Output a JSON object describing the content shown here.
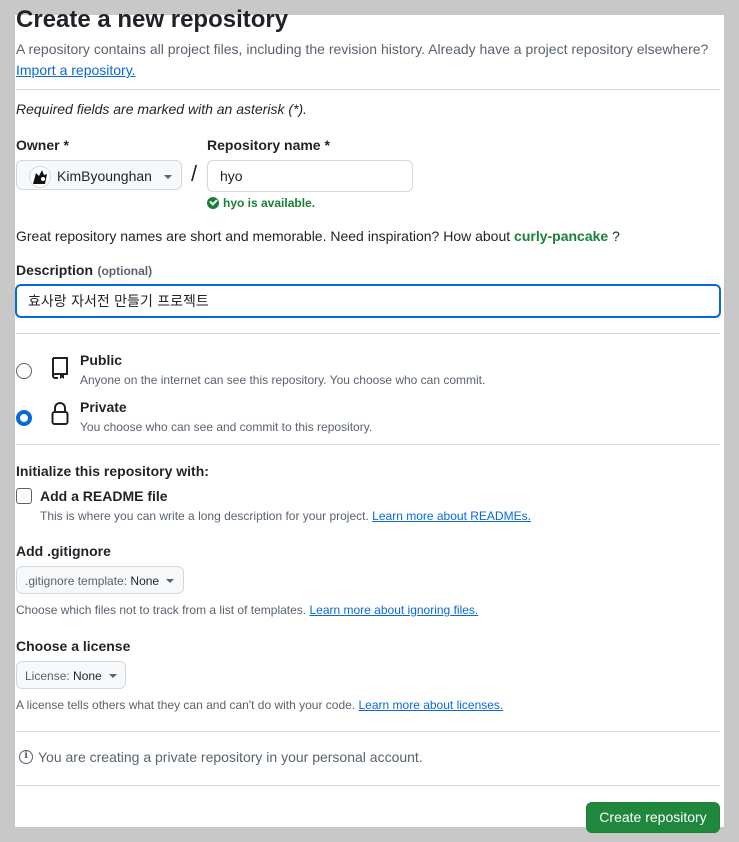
{
  "header": {
    "title": "Create a new repository",
    "intro": "A repository contains all project files, including the revision history. Already have a project repository elsewhere?",
    "import_link": "Import a repository."
  },
  "required_note": "Required fields are marked with an asterisk (*).",
  "owner": {
    "label": "Owner *",
    "value": "KimByounghan"
  },
  "separator": "/",
  "repo_name": {
    "label": "Repository name *",
    "value": "hyo",
    "availability": "hyo is available."
  },
  "inspiration": {
    "text": "Great repository names are short and memorable. Need inspiration? How about",
    "suggestion": "curly-pancake",
    "suffix": "?"
  },
  "description": {
    "label": "Description",
    "optional": "(optional)",
    "value": "효사랑 자서전 만들기 프로젝트"
  },
  "visibility": {
    "options": [
      {
        "title": "Public",
        "desc": "Anyone on the internet can see this repository. You choose who can commit.",
        "selected": false
      },
      {
        "title": "Private",
        "desc": "You choose who can see and commit to this repository.",
        "selected": true
      }
    ]
  },
  "initialize": {
    "heading": "Initialize this repository with:",
    "readme": {
      "label": "Add a README file",
      "desc": "This is where you can write a long description for your project.",
      "link": "Learn more about READMEs.",
      "checked": false
    }
  },
  "gitignore": {
    "heading": "Add .gitignore",
    "button_prefix": ".gitignore template:",
    "button_value": "None",
    "desc": "Choose which files not to track from a list of templates.",
    "link": "Learn more about ignoring files."
  },
  "license": {
    "heading": "Choose a license",
    "button_prefix": "License:",
    "button_value": "None",
    "desc": "A license tells others what they can and can't do with your code.",
    "link": "Learn more about licenses."
  },
  "notice": "You are creating a private repository in your personal account.",
  "submit": "Create repository",
  "colors": {
    "primary_button": "#1f883d",
    "link": "#0969da",
    "success": "#1a7f37",
    "focus": "#0969da"
  }
}
